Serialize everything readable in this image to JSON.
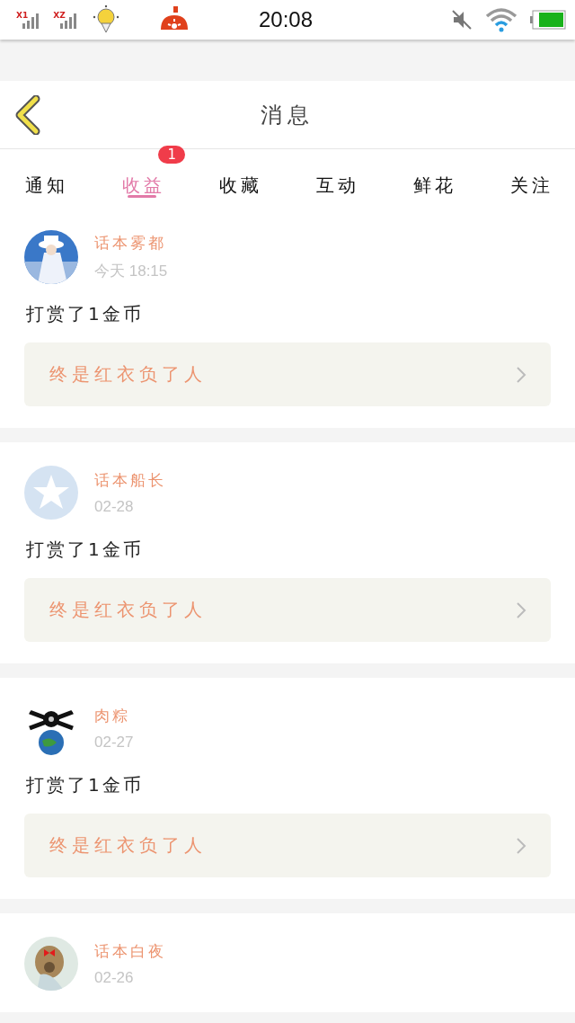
{
  "status_bar": {
    "time": "20:08",
    "sim_labels": [
      "X1",
      "XZ"
    ]
  },
  "header": {
    "title": "消息"
  },
  "tabs": [
    {
      "label": "通知",
      "selected": false
    },
    {
      "label": "收益",
      "selected": true,
      "badge": "1"
    },
    {
      "label": "收藏",
      "selected": false
    },
    {
      "label": "互动",
      "selected": false
    },
    {
      "label": "鲜花",
      "selected": false
    },
    {
      "label": "关注",
      "selected": false
    }
  ],
  "messages": [
    {
      "name": "话本雾都",
      "time": "今天 18:15",
      "text": "打赏了1金币",
      "work": "终是红衣负了人"
    },
    {
      "avatar": {
        "kind": "default"
      },
      "name": "话本船长",
      "time": "02-28",
      "text": "打赏了1金币",
      "work": "终是红衣负了人"
    },
    {
      "name": "肉粽",
      "time": "02-27",
      "text": "打赏了1金币",
      "work": "终是红衣负了人"
    },
    {
      "name": "话本白夜",
      "time": "02-26"
    }
  ]
}
